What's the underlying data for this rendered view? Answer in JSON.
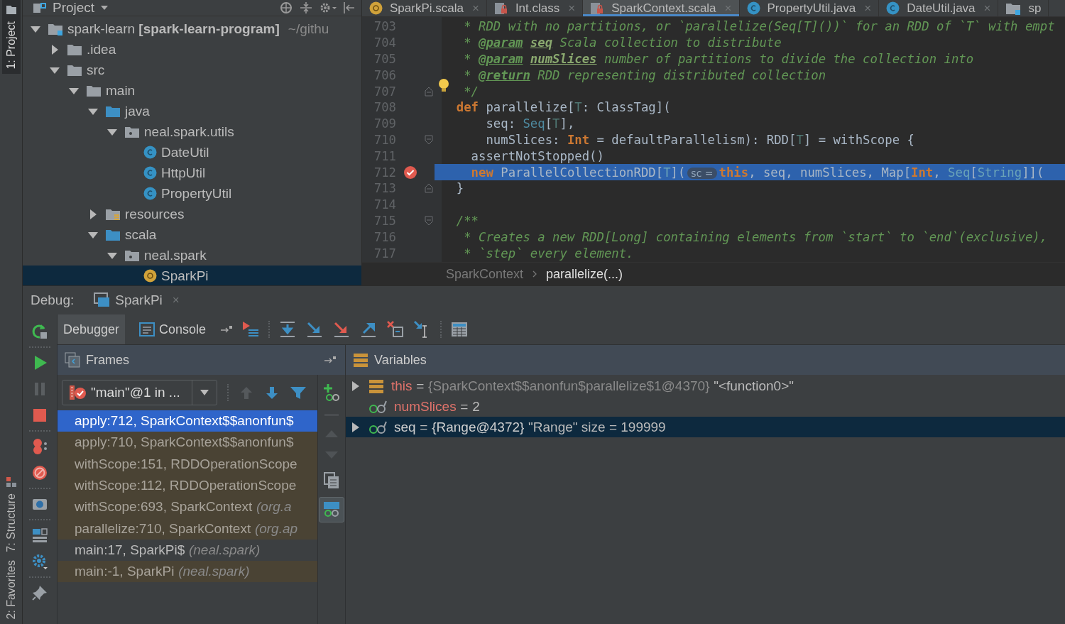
{
  "side_tabs": {
    "top": [
      {
        "label": "1: Project",
        "selected": true
      }
    ],
    "bottom": [
      {
        "label": "7: Structure",
        "selected": false
      },
      {
        "label": "2: Favorites",
        "selected": false
      }
    ]
  },
  "project_panel": {
    "title": "Project",
    "tree": [
      {
        "label": "spark-learn **[spark-learn-program]**",
        "hint": "~/githu",
        "kind": "module",
        "expanded": true,
        "selected": false,
        "children": [
          {
            "label": ".idea",
            "kind": "folder",
            "expanded": false,
            "selected": false
          },
          {
            "label": "src",
            "kind": "folder",
            "expanded": true,
            "selected": false,
            "children": [
              {
                "label": "main",
                "kind": "folder",
                "expanded": true,
                "selected": false,
                "children": [
                  {
                    "label": "java",
                    "kind": "source",
                    "expanded": true,
                    "selected": false,
                    "children": [
                      {
                        "label": "neal.spark.utils",
                        "kind": "package",
                        "expanded": true,
                        "selected": false,
                        "children": [
                          {
                            "label": "DateUtil",
                            "kind": "class",
                            "selected": false
                          },
                          {
                            "label": "HttpUtil",
                            "kind": "class",
                            "selected": false
                          },
                          {
                            "label": "PropertyUtil",
                            "kind": "class",
                            "selected": false
                          }
                        ]
                      }
                    ]
                  },
                  {
                    "label": "resources",
                    "kind": "resources",
                    "expanded": false,
                    "selected": false
                  },
                  {
                    "label": "scala",
                    "kind": "source",
                    "expanded": true,
                    "selected": false,
                    "children": [
                      {
                        "label": "neal.spark",
                        "kind": "package",
                        "expanded": true,
                        "selected": false,
                        "children": [
                          {
                            "label": "SparkPi",
                            "kind": "object",
                            "selected": true
                          }
                        ]
                      }
                    ]
                  }
                ]
              }
            ]
          }
        ]
      }
    ]
  },
  "editor": {
    "tabs": [
      {
        "label": "SparkPi.scala",
        "kind": "object",
        "close": "×",
        "selected": false
      },
      {
        "label": "Int.class",
        "kind": "locked",
        "close": "×",
        "selected": false
      },
      {
        "label": "SparkContext.scala",
        "kind": "locked",
        "close": "×",
        "selected": true
      },
      {
        "label": "PropertyUtil.java",
        "kind": "class",
        "close": "×",
        "selected": false
      },
      {
        "label": "DateUtil.java",
        "kind": "class",
        "close": "×",
        "selected": false
      },
      {
        "label": "sp",
        "kind": "module",
        "selected": false
      }
    ],
    "lines": [
      {
        "number": "703",
        "kind": "plain",
        "selected": false,
        "tokens": [
          {
            "kind": "comment",
            "t": "   * RDD with no partitions, or `parallelize(Seq[T]())` for an RDD of `T` with empt"
          }
        ]
      },
      {
        "number": "704",
        "kind": "plain",
        "selected": false,
        "tokens": [
          {
            "kind": "comment",
            "t": "   * "
          },
          {
            "kind": "doctag",
            "t": "@param"
          },
          {
            "kind": "docref",
            "t": "seq"
          },
          {
            "kind": "comment",
            "t": " Scala collection to distribute"
          }
        ]
      },
      {
        "number": "705",
        "kind": "plain",
        "selected": false,
        "tokens": [
          {
            "kind": "comment",
            "t": "   * "
          },
          {
            "kind": "doctag",
            "t": "@param"
          },
          {
            "kind": "docref",
            "t": "numSlices"
          },
          {
            "kind": "comment",
            "t": " number of partitions to divide the collection into"
          }
        ]
      },
      {
        "number": "706",
        "kind": "plain",
        "selected": false,
        "tokens": [
          {
            "kind": "comment",
            "t": "   * "
          },
          {
            "kind": "doctag",
            "t": "@return"
          },
          {
            "kind": "comment",
            "t": " RDD representing distributed collection"
          }
        ]
      },
      {
        "number": "707",
        "kind": "hint",
        "selected": false,
        "tokens": [
          {
            "kind": "comment",
            "t": "   */"
          }
        ]
      },
      {
        "number": "708",
        "kind": "plain",
        "selected": false,
        "tokens": [
          {
            "kind": "keyword",
            "t": "  def"
          },
          {
            "kind": "plain",
            "t": " parallelize["
          },
          {
            "kind": "tparam",
            "t": "T"
          },
          {
            "kind": "plain",
            "t": ": ClassTag]("
          }
        ]
      },
      {
        "number": "709",
        "kind": "plain",
        "selected": false,
        "tokens": [
          {
            "kind": "plain",
            "t": "      seq: "
          },
          {
            "kind": "type",
            "t": "Seq"
          },
          {
            "kind": "plain",
            "t": "["
          },
          {
            "kind": "tparam",
            "t": "T"
          },
          {
            "kind": "plain",
            "t": "],"
          }
        ]
      },
      {
        "number": "710",
        "kind": "fold",
        "selected": false,
        "tokens": [
          {
            "kind": "plain",
            "t": "      numSlices: "
          },
          {
            "kind": "keyword",
            "t": "Int"
          },
          {
            "kind": "plain",
            "t": " = defaultParallelism): RDD["
          },
          {
            "kind": "tparam",
            "t": "T"
          },
          {
            "kind": "plain",
            "t": "] = withScope {"
          }
        ]
      },
      {
        "number": "711",
        "kind": "plain",
        "selected": false,
        "tokens": [
          {
            "kind": "plain",
            "t": "    assertNotStopped()"
          }
        ]
      },
      {
        "number": "712",
        "kind": "breakpoint",
        "selected": true,
        "tokens": [
          {
            "kind": "keyword",
            "t": "    new"
          },
          {
            "kind": "plain",
            "t": " ParallelCollectionRDD["
          },
          {
            "kind": "tparam",
            "t": "T"
          },
          {
            "kind": "plain",
            "t": "]("
          },
          {
            "kind": "hint",
            "t": "sc ="
          },
          {
            "kind": "keyword",
            "t": "this"
          },
          {
            "kind": "plain",
            "t": ", seq, numSlices, Map["
          },
          {
            "kind": "keyword",
            "t": "Int"
          },
          {
            "kind": "plain",
            "t": ", "
          },
          {
            "kind": "type",
            "t": "Seq"
          },
          {
            "kind": "plain",
            "t": "["
          },
          {
            "kind": "type",
            "t": "String"
          },
          {
            "kind": "plain",
            "t": "]]("
          }
        ]
      },
      {
        "number": "713",
        "kind": "unfold",
        "selected": false,
        "tokens": [
          {
            "kind": "plain",
            "t": "  }"
          }
        ]
      },
      {
        "number": "714",
        "kind": "plain",
        "selected": false
      },
      {
        "number": "715",
        "kind": "fold",
        "selected": false,
        "tokens": [
          {
            "kind": "comment",
            "t": "  /**"
          }
        ]
      },
      {
        "number": "716",
        "kind": "plain",
        "selected": false,
        "tokens": [
          {
            "kind": "comment",
            "t": "   * Creates a new RDD[Long] containing elements from `start` to `end`(exclusive),"
          }
        ]
      },
      {
        "number": "717",
        "kind": "plain",
        "selected": false,
        "tokens": [
          {
            "kind": "comment",
            "t": "   * `step` every element."
          }
        ]
      }
    ],
    "breadcrumb": [
      "SparkContext",
      "parallelize(...)"
    ]
  },
  "debug": {
    "label": "Debug:",
    "session": {
      "label": "SparkPi",
      "close": "×"
    },
    "tabs": [
      {
        "label": "Debugger",
        "selected": true
      },
      {
        "label": "Console",
        "selected": false
      }
    ],
    "frames_title": "Frames",
    "variables_title": "Variables",
    "thread": "\"main\"@1 in ...",
    "frames": [
      {
        "text": "apply:712, SparkContext$$anonfun$",
        "selected": true,
        "library": false
      },
      {
        "text": "apply:710, SparkContext$$anonfun$",
        "selected": false,
        "library": true
      },
      {
        "text": "withScope:151, RDDOperationScope",
        "selected": false,
        "library": true
      },
      {
        "text": "withScope:112, RDDOperationScope",
        "selected": false,
        "library": true
      },
      {
        "text": "withScope:693, SparkContext",
        "location": "(org.a",
        "selected": false,
        "library": true
      },
      {
        "text": "parallelize:710, SparkContext",
        "location": "(org.ap",
        "selected": false,
        "library": true
      },
      {
        "text": "main:17, SparkPi$",
        "location": "(neal.spark)",
        "selected": false,
        "library": false
      },
      {
        "text": "main:-1, SparkPi",
        "location": "(neal.spark)",
        "selected": false,
        "library": true
      }
    ],
    "variables": [
      {
        "name": "this",
        "kind": "field",
        "sep": "=",
        "ref": "{SparkContext$$anonfun$parallelize$1@4370}",
        "value": "\"<function0>\"",
        "expanded": false,
        "selected": false
      },
      {
        "name": "numSlices",
        "kind": "watch",
        "sep": "=",
        "value": "2",
        "selected": false
      },
      {
        "name": "seq",
        "kind": "watch",
        "sep": "=",
        "ref": "{Range@4372}",
        "value": "\"Range\" size = 199999",
        "expanded": false,
        "selected": true
      }
    ]
  }
}
